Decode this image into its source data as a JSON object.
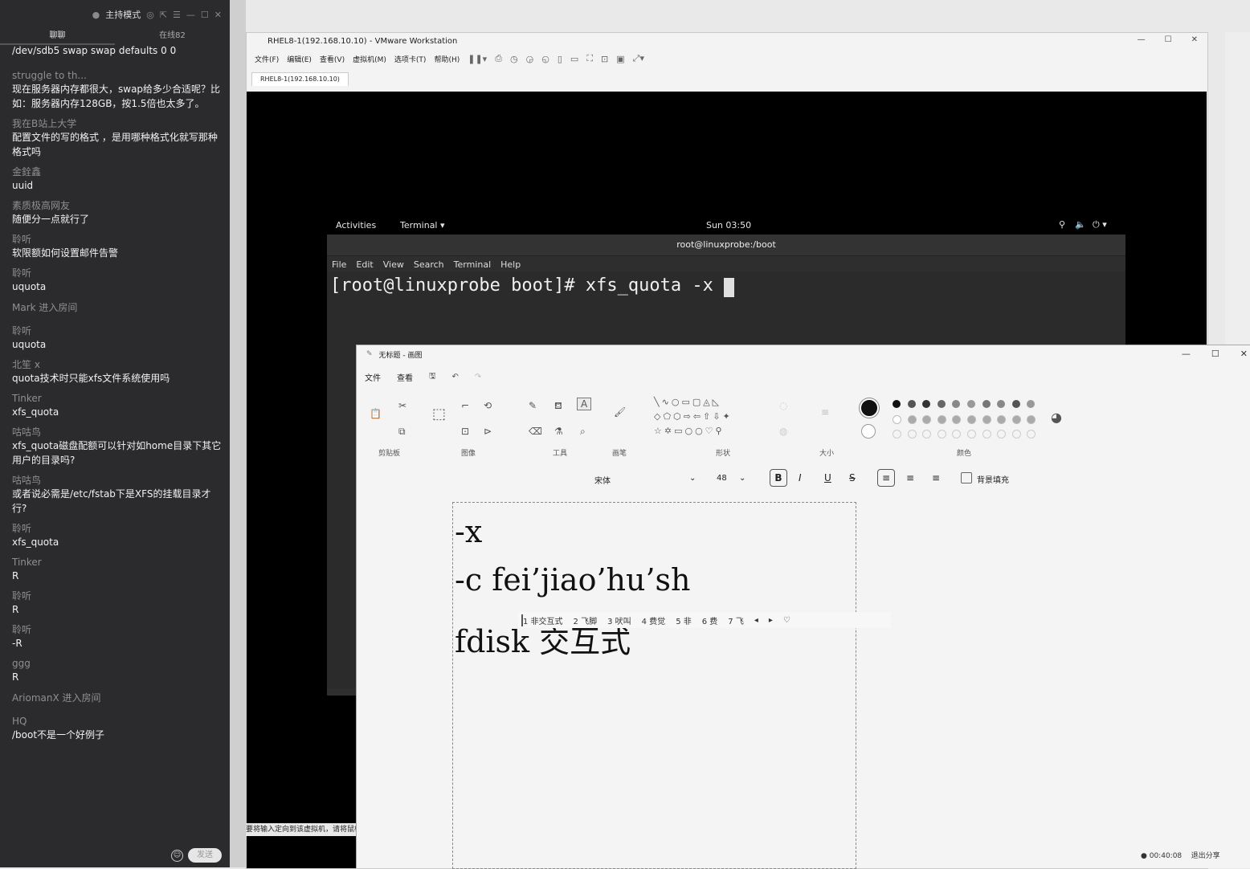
{
  "chat": {
    "mode_label": "主持模式",
    "tabs": [
      "聊聊",
      "在线82"
    ],
    "first_line": "/dev/sdb5 swap swap defaults 0 0",
    "messages": [
      {
        "user": "struggle to th...",
        "text": "现在服务器内存都很大，swap给多少合适呢？比如：服务器内存128GB，按1.5倍也太多了。"
      },
      {
        "user": "我在B站上大学",
        "text": "配置文件的写的格式 ，是用哪种格式化就写那种格式吗"
      },
      {
        "user": "金銓鑫",
        "text": "uuid"
      },
      {
        "user": "素质极高网友",
        "text": "随便分一点就行了"
      },
      {
        "user": "聆听",
        "text": "软限额如何设置邮件告警"
      },
      {
        "user": "聆听",
        "text": "uquota"
      },
      {
        "system": "Mark 进入房间"
      },
      {
        "user": "聆听",
        "text": "uquota"
      },
      {
        "user": "北笙 x",
        "text": "quota技术时只能xfs文件系统使用吗"
      },
      {
        "user": "Tinker",
        "text": "xfs_quota"
      },
      {
        "user": "咕咕鸟",
        "text": "xfs_quota磁盘配额可以针对如home目录下其它用户的目录吗?"
      },
      {
        "user": "咕咕鸟",
        "text": "或者说必需是/etc/fstab下是XFS的挂载目录才行?"
      },
      {
        "user": "聆听",
        "text": "xfs_quota"
      },
      {
        "user": "Tinker",
        "text": "R"
      },
      {
        "user": "聆听",
        "text": "R"
      },
      {
        "user": "聆听",
        "text": "-R"
      },
      {
        "user": "ggg",
        "text": "R"
      },
      {
        "system": "AriomanX 进入房间"
      },
      {
        "user": "HQ",
        "text": "/boot不是一个好例子"
      }
    ],
    "send_label": "发送"
  },
  "vmware": {
    "title": "RHEL8-1(192.168.10.10) - VMware Workstation",
    "menu": [
      "文件(F)",
      "编辑(E)",
      "查看(V)",
      "虚拟机(M)",
      "选项卡(T)",
      "帮助(H)"
    ],
    "tab": "RHEL8-1(192.168.10.10)",
    "hint": "要将输入定向到该虚拟机，请将鼠标指针移入其中或按 Ctrl+G。"
  },
  "gnome": {
    "activities": "Activities",
    "app": "Terminal ▾",
    "clock": "Sun 03:50"
  },
  "terminal": {
    "title": "root@linuxprobe:/boot",
    "menu": [
      "File",
      "Edit",
      "View",
      "Search",
      "Terminal",
      "Help"
    ],
    "prompt": "[root@linuxprobe boot]# xfs_quota -x "
  },
  "paint": {
    "title": "无标题 - 画图",
    "menu": [
      "文件",
      "查看"
    ],
    "groups": [
      "剪贴板",
      "图像",
      "工具",
      "画笔",
      "形状",
      "大小",
      "颜色"
    ],
    "font_name": "宋体",
    "font_size": "48",
    "bg_fill_label": "背景填充",
    "canvas_lines": [
      "-x",
      "-c fei’jiao’hu’sh",
      "fdisk 交互式"
    ],
    "ime_candidates": [
      "1 非交互式",
      "2 飞脚",
      "3 吠叫",
      "4 费觉",
      "5 非",
      "6 费",
      "7 飞"
    ],
    "status_time": "00:40:08",
    "status_exit": "退出分享",
    "colors": {
      "row1": [
        "#111111",
        "#555555",
        "#333333",
        "#666666",
        "#888888",
        "#999999",
        "#777777",
        "#888888",
        "#555555",
        "#999999"
      ]
    }
  }
}
